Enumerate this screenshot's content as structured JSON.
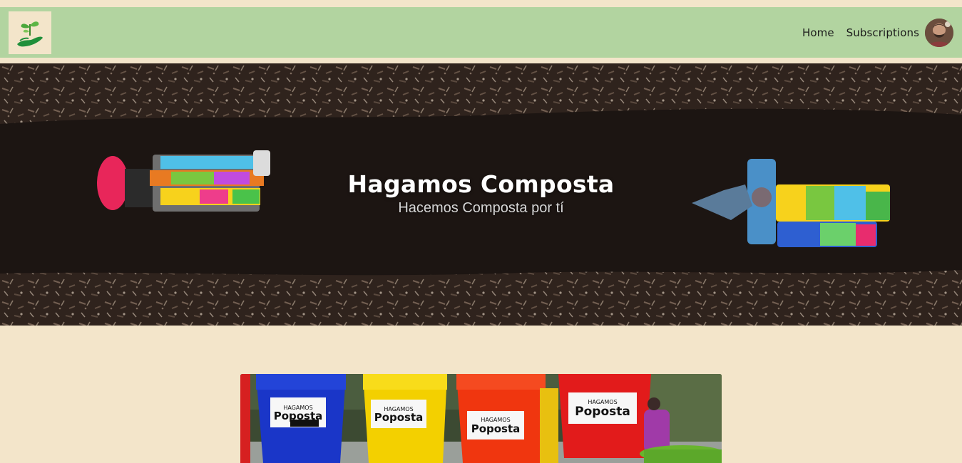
{
  "navbar": {
    "logo_icon": "sprout-in-hand-icon",
    "links": [
      {
        "label": "Home"
      },
      {
        "label": "Subscriptions"
      }
    ],
    "avatar_icon": "user-avatar"
  },
  "hero": {
    "title": "Hagamos Composta",
    "subtitle": "Hacemos Composta por tí"
  },
  "photo": {
    "bucket_colors": [
      "#1a36c8",
      "#f3d000",
      "#f0360f",
      "#e21b1b",
      "#69b52e"
    ]
  },
  "colors": {
    "background": "#f3e5ca",
    "navbar": "#b2d4a0",
    "logo_green": "#1f8f3a"
  }
}
